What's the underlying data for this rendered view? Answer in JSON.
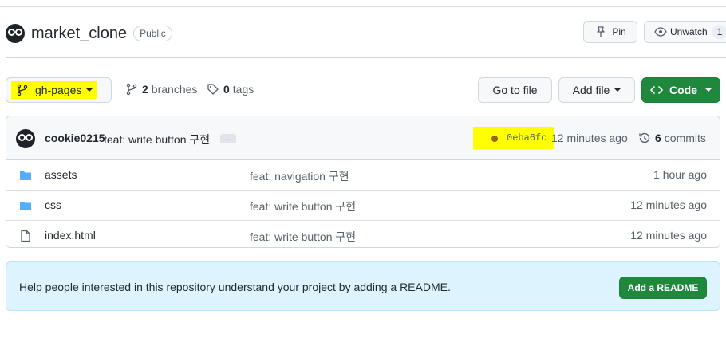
{
  "repo": {
    "name": "market_clone",
    "visibility": "Public"
  },
  "header_actions": {
    "pin_label": "Pin",
    "watch_label": "Unwatch",
    "watch_count": "1"
  },
  "toolbar": {
    "branch": "gh-pages",
    "branches_count": "2",
    "branches_label": "branches",
    "tags_count": "0",
    "tags_label": "tags",
    "goto_file": "Go to file",
    "add_file": "Add file",
    "code": "Code"
  },
  "commit": {
    "author": "cookie0215",
    "message": "feat: write button 구현",
    "ellipsis": "…",
    "sha": "0eba6fc",
    "time": "12 minutes ago",
    "commits_count": "6",
    "commits_label": "commits"
  },
  "files": [
    {
      "name": "assets",
      "type": "folder",
      "message": "feat: navigation 구현",
      "time": "1 hour ago"
    },
    {
      "name": "css",
      "type": "folder",
      "message": "feat: write button 구현",
      "time": "12 minutes ago"
    },
    {
      "name": "index.html",
      "type": "file",
      "message": "feat: write button 구현",
      "time": "12 minutes ago"
    }
  ],
  "readme_banner": {
    "text": "Help people interested in this repository understand your project by adding a README.",
    "button": "Add a README"
  },
  "colors": {
    "primary_green": "#1f883d",
    "folder_blue": "#54aeff",
    "highlight": "#ffff00",
    "banner_bg": "#ddf4ff"
  }
}
